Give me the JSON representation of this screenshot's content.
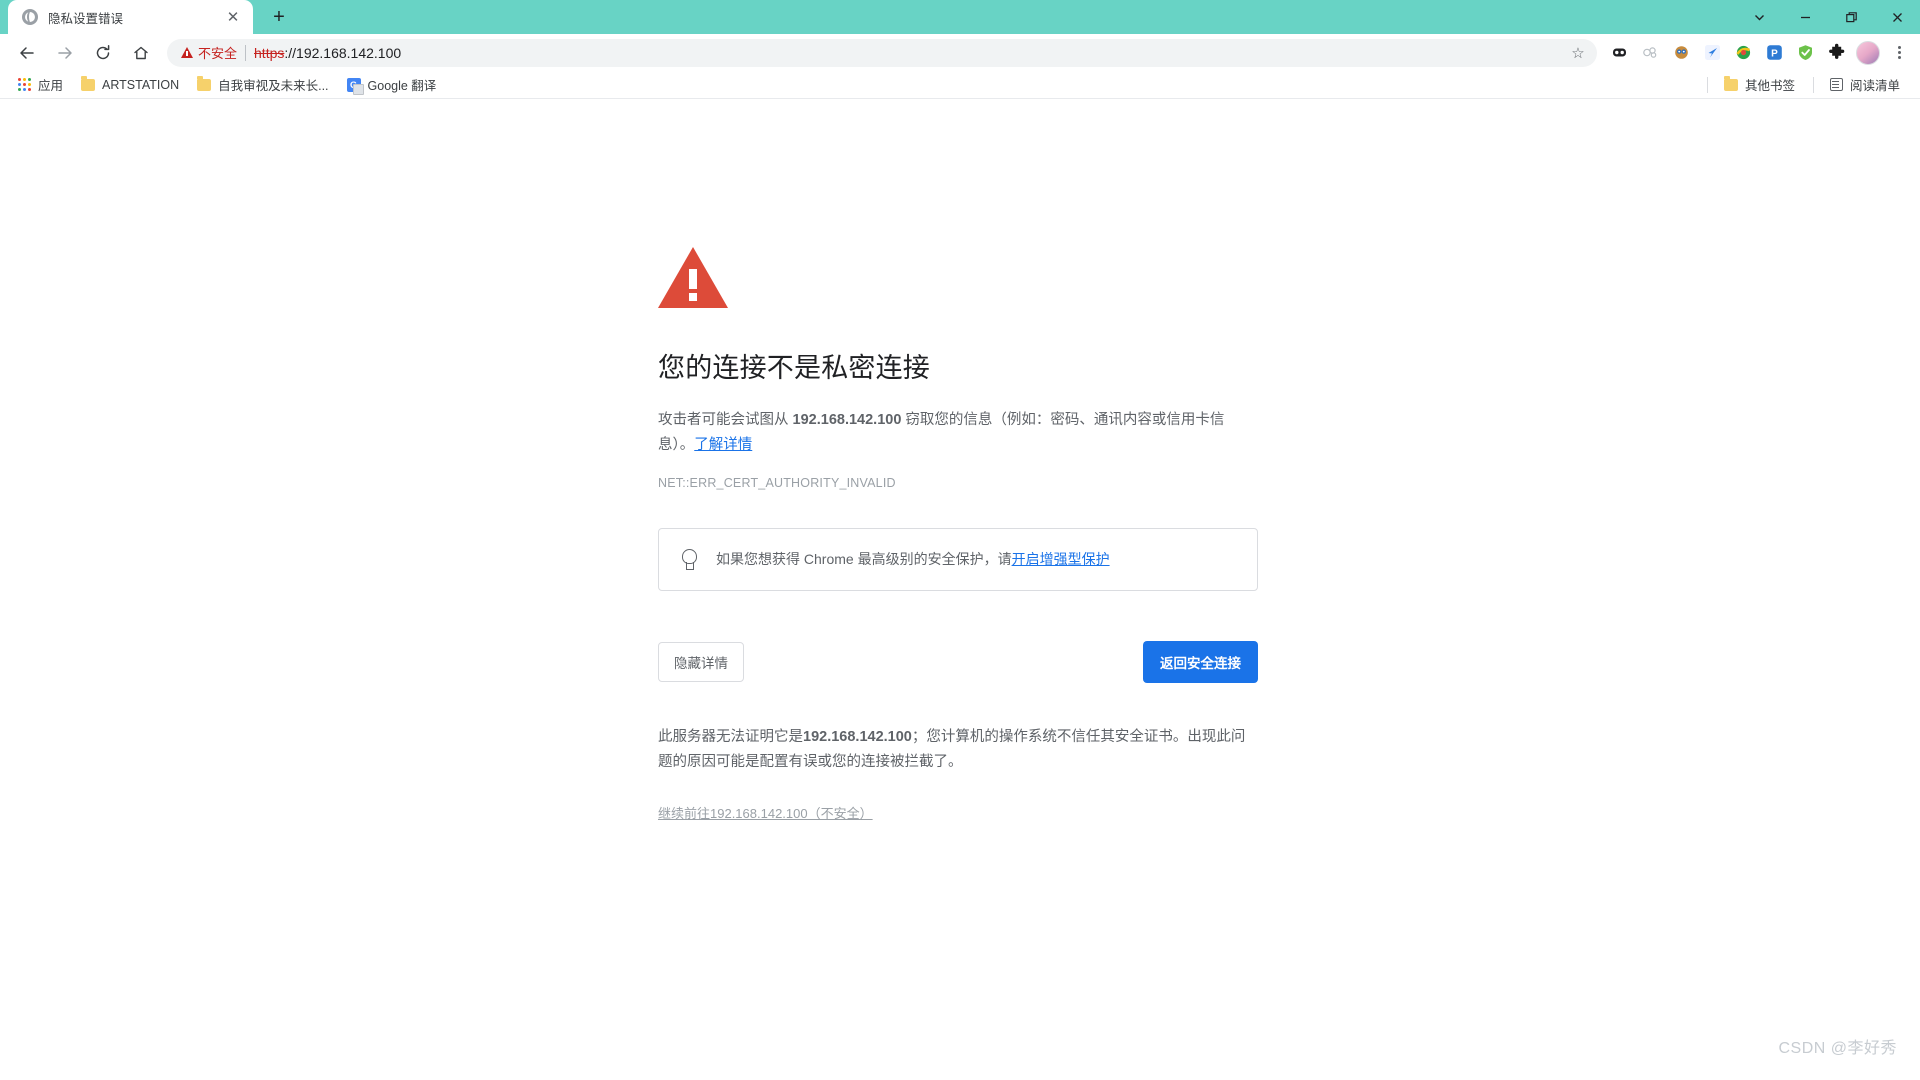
{
  "window": {
    "controls": {
      "tab_search": "tab-search",
      "minimize": "minimize",
      "maximize": "maximize",
      "close": "close"
    },
    "tabstrip_color": "#68d3c5"
  },
  "tab": {
    "title": "隐私设置错误",
    "close_label": "✕",
    "new_tab_label": "+"
  },
  "toolbar": {
    "back_label": "←",
    "forward_label": "→",
    "reload_label": "⟳",
    "home_label": "⌂",
    "security_label": "不安全",
    "url_scheme": "https",
    "url_rest": "://192.168.142.100",
    "star_label": "☆",
    "extensions": [
      {
        "name": "extension-icon-1",
        "glyph": "◼"
      },
      {
        "name": "extension-icon-2",
        "glyph": "◍"
      },
      {
        "name": "extension-icon-3",
        "glyph": "◉"
      },
      {
        "name": "extension-icon-4",
        "glyph": "◆"
      },
      {
        "name": "extension-icon-5",
        "glyph": "●"
      },
      {
        "name": "extension-icon-6",
        "glyph": "P"
      },
      {
        "name": "extension-icon-shield",
        "glyph": "▼"
      },
      {
        "name": "extension-icon-puzzle",
        "glyph": "✦"
      }
    ]
  },
  "bookmarks": {
    "apps_label": "应用",
    "items": [
      {
        "label": "ARTSTATION",
        "icon": "folder-icon"
      },
      {
        "label": "自我审视及未来长...",
        "icon": "folder-icon"
      },
      {
        "label": "Google 翻译",
        "icon": "google-translate-icon"
      }
    ],
    "other_bookmarks": "其他书签",
    "reading_list": "阅读清单"
  },
  "interstitial": {
    "icon": "warning-triangle-icon",
    "title": "您的连接不是私密连接",
    "body_prefix": "攻击者可能会试图从 ",
    "body_host": "192.168.142.100",
    "body_middle": " 窃取您的信息（例如：密码、通讯内容或信用卡信息）。",
    "learn_more": "了解详情",
    "error_code": "NET::ERR_CERT_AUTHORITY_INVALID",
    "callout_text": "如果您想获得 Chrome 最高级别的安全保护，请",
    "callout_link": "开启增强型保护",
    "hide_details_button": "隐藏详情",
    "back_to_safety_button": "返回安全连接",
    "detail_prefix": "此服务器无法证明它是",
    "detail_host": "192.168.142.100",
    "detail_suffix": "；您计算机的操作系统不信任其安全证书。出现此问题的原因可能是配置有误或您的连接被拦截了。",
    "proceed_link": "继续前往192.168.142.100（不安全）"
  },
  "watermark": "CSDN @李好秀",
  "colors": {
    "danger": "#dd4b39",
    "omnibox_warn": "#c5221f",
    "link": "#1a73e8",
    "primary_button": "#1a73e8",
    "tabstrip": "#68d3c5"
  }
}
